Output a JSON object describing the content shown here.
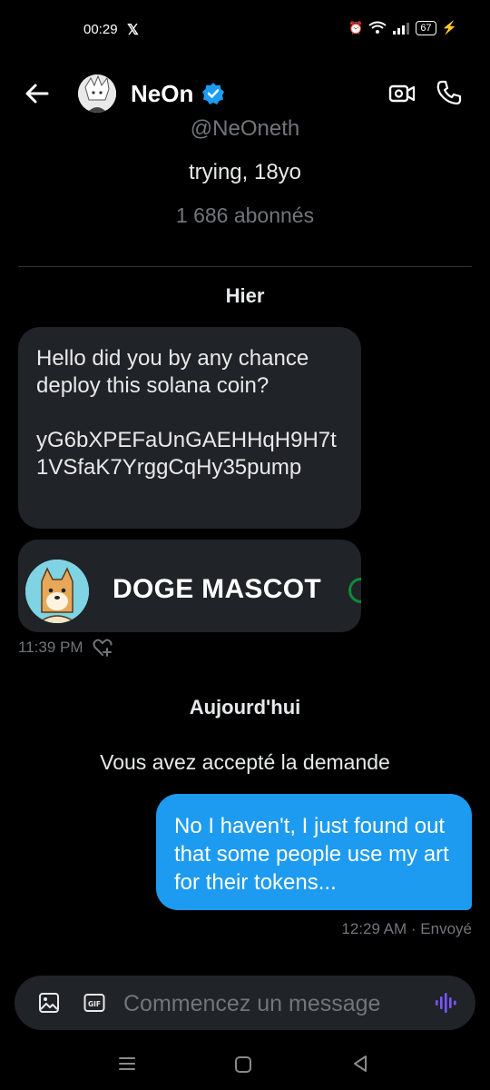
{
  "status_bar": {
    "time": "00:29",
    "app_icon": "x-logo",
    "battery": "67"
  },
  "header": {
    "name": "NeOn",
    "verified": true
  },
  "profile": {
    "handle": "@NeOneth",
    "bio": "trying, 18yo",
    "followers": "1 686 abonnés"
  },
  "days": {
    "yesterday": "Hier",
    "today": "Aujourd'hui"
  },
  "incoming": {
    "text": "Hello did you by any chance deploy this solana coin?",
    "address": "yG6bXPEFaUnGAEHHqH9H7t1VSfaK7YrggCqHy35pump",
    "card_title": "DOGE MASCOT",
    "time": "11:39 PM"
  },
  "notice": "Vous avez accepté la demande",
  "outgoing": {
    "text": "No I haven't, I just found out that some people use my art for their tokens...",
    "meta": "12:29 AM · Envoyé"
  },
  "composer": {
    "placeholder": "Commencez un message"
  },
  "colors": {
    "accent": "#1d9bf0",
    "bubble_in": "#202327",
    "background": "#000000"
  }
}
